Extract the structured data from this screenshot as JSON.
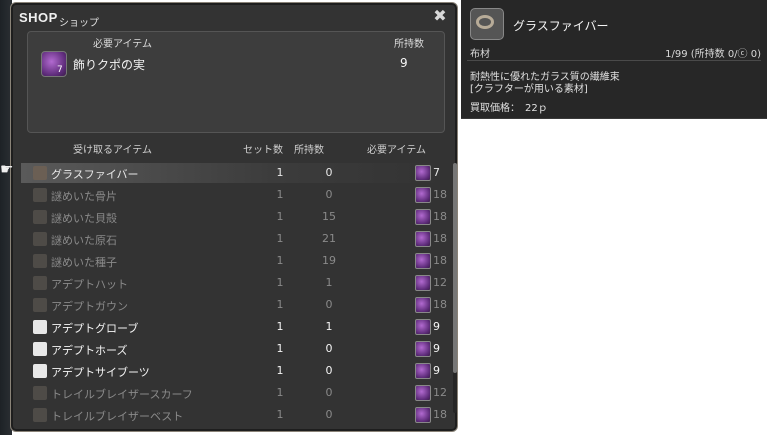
{
  "window": {
    "title": "SHOP",
    "subtitle": "ショップ"
  },
  "required": {
    "header_item": "必要アイテム",
    "header_owned": "所持数",
    "item_name": "飾りクポの実",
    "icon_qty": "7",
    "owned": "9"
  },
  "columns": {
    "receive": "受け取るアイテム",
    "sets": "セット数",
    "owned": "所持数",
    "needed": "必要アイテム"
  },
  "rows": [
    {
      "name": "グラスファイバー",
      "sets": "1",
      "owned": "0",
      "need": "7",
      "state": "selected"
    },
    {
      "name": "謎めいた骨片",
      "sets": "1",
      "owned": "0",
      "need": "18",
      "state": "dim"
    },
    {
      "name": "謎めいた貝殻",
      "sets": "1",
      "owned": "15",
      "need": "18",
      "state": "dim"
    },
    {
      "name": "謎めいた原石",
      "sets": "1",
      "owned": "21",
      "need": "18",
      "state": "dim"
    },
    {
      "name": "謎めいた種子",
      "sets": "1",
      "owned": "19",
      "need": "18",
      "state": "dim"
    },
    {
      "name": "アデプトハット",
      "sets": "1",
      "owned": "1",
      "need": "12",
      "state": "dim"
    },
    {
      "name": "アデプトガウン",
      "sets": "1",
      "owned": "0",
      "need": "18",
      "state": "dim"
    },
    {
      "name": "アデプトグローブ",
      "sets": "1",
      "owned": "1",
      "need": "9",
      "state": "bright"
    },
    {
      "name": "アデプトホーズ",
      "sets": "1",
      "owned": "0",
      "need": "9",
      "state": "bright"
    },
    {
      "name": "アデプトサイブーツ",
      "sets": "1",
      "owned": "0",
      "need": "9",
      "state": "bright"
    },
    {
      "name": "トレイルブレイザースカーフ",
      "sets": "1",
      "owned": "0",
      "need": "12",
      "state": "dim"
    },
    {
      "name": "トレイルブレイザーベスト",
      "sets": "1",
      "owned": "0",
      "need": "18",
      "state": "dim"
    }
  ],
  "tooltip": {
    "name": "グラスファイバー",
    "category": "布材",
    "stack": "1/99 (所持数 0/ⓒ 0)",
    "desc_line1": "耐熱性に優れたガラス質の繊維束",
    "desc_line2": "[クラフターが用いる素材]",
    "price_label": "買取価格：",
    "price": "22ｐ"
  },
  "icons": {
    "close": "close-icon",
    "pointer": "hand-pointer-icon"
  }
}
